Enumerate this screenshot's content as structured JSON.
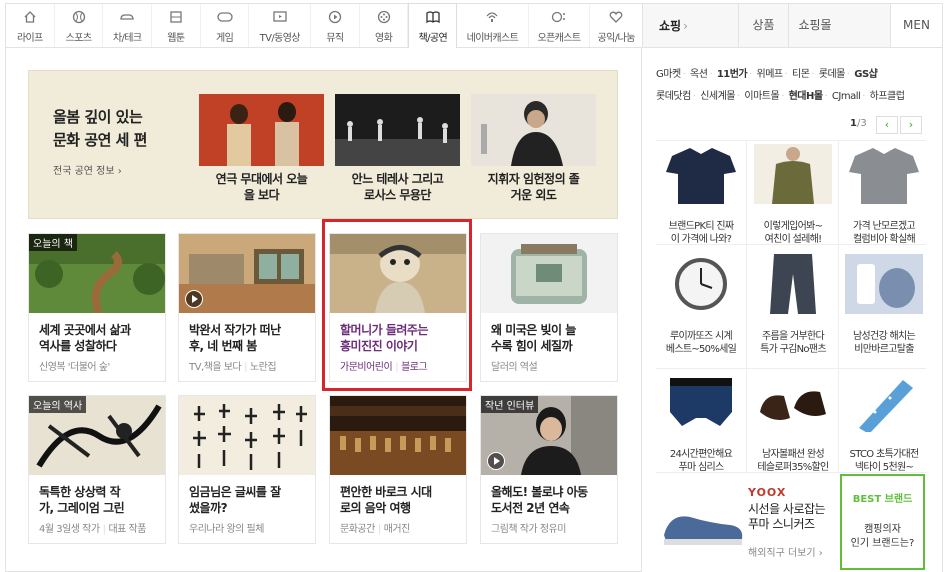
{
  "nav": {
    "tabs": [
      {
        "label": "라이프",
        "icon": "home-icon"
      },
      {
        "label": "스포츠",
        "icon": "ball-icon"
      },
      {
        "label": "차/테크",
        "icon": "car-icon"
      },
      {
        "label": "웹툰",
        "icon": "webtoon-icon"
      },
      {
        "label": "게임",
        "icon": "gamepad-icon"
      },
      {
        "label": "TV/동영상",
        "icon": "tv-icon"
      },
      {
        "label": "뮤직",
        "icon": "play-icon"
      },
      {
        "label": "영화",
        "icon": "film-reel-icon"
      },
      {
        "label": "책/공연",
        "icon": "book-icon"
      },
      {
        "label": "네이버캐스트",
        "icon": "cast-icon"
      },
      {
        "label": "오픈캐스트",
        "icon": "opencast-icon"
      },
      {
        "label": "공익/나눔",
        "icon": "heart-icon"
      }
    ],
    "active": "책/공연"
  },
  "shop": {
    "title": "쇼핑",
    "arrow": "›",
    "tabs": [
      "상품",
      "쇼핑몰"
    ],
    "men": "MEN",
    "brand_rows": [
      [
        "G마켓",
        "옥션",
        "11번가",
        "위메프",
        "티몬",
        "롯데몰",
        "GS샵"
      ],
      [
        "롯데닷컴",
        "신세계몰",
        "이마트몰",
        "현대H몰",
        "CJmall",
        "하프클럽"
      ]
    ],
    "pager": {
      "current": "1",
      "total": "3",
      "prev": "‹",
      "next": "›"
    },
    "products": [
      {
        "line1": "브랜드PK티 진짜",
        "line2": "이 가격에 나와?"
      },
      {
        "line1": "이렇게입어봐~",
        "line2": "여친이 설레해!"
      },
      {
        "line1": "가격 난모르겠고",
        "line2": "컬럼비아 확실해"
      },
      {
        "line1": "루이까또즈 시계",
        "line2": "베스트~50%세일"
      },
      {
        "line1": "주름을 거부한다",
        "line2": "특가 구김No팬츠"
      },
      {
        "line1": "남성건강 해치는",
        "line2": "비만바르고탈출"
      },
      {
        "line1": "24시간편안해요",
        "line2": "푸마 심리스"
      },
      {
        "line1": "남자볼패션 완성",
        "line2": "테슬로퍼35%할인"
      },
      {
        "line1": "STCO 초특가대전",
        "line2": "넥타이 5천원~"
      }
    ],
    "banner": {
      "brand": "YOOX",
      "line1": "시선을 사로잡는",
      "line2": "푸마 스니커즈",
      "sub": "해외직구 더보기 ›"
    },
    "best": {
      "heading": "BEST 브랜드",
      "line1": "캠핑의자",
      "line2": "인기 브랜드는?"
    }
  },
  "feature": {
    "title_line1": "올봄 깊이 있는",
    "title_line2": "문화 공연 세 편",
    "link": "전국 공연 정보 ›",
    "items": [
      {
        "line1": "연극 무대에서 오늘",
        "line2": "을 보다"
      },
      {
        "line1": "안느 테레사 그리고",
        "line2": "로사스 무용단"
      },
      {
        "line1": "지휘자 임헌정의 졸",
        "line2": "거운 외도"
      }
    ]
  },
  "cards": [
    {
      "badge": "오늘의 책",
      "line1": "세계 곳곳에서 삶과",
      "line2": "역사를 성찰하다",
      "source": "신영복 '더불어 숲'",
      "sub": ""
    },
    {
      "badge": "",
      "line1": "박완서 작가가 떠난",
      "line2": "후, 네 번째 봄",
      "source": "TV,책을 보다",
      "sub": "노란집"
    },
    {
      "badge": "",
      "line1": "할머니가 들려주는",
      "line2": "흥미진진 이야기",
      "source": "가문비어린이",
      "sub": "블로그"
    },
    {
      "badge": "",
      "line1": "왜 미국은 빚이 늘",
      "line2": "수록 힘이 세질까",
      "source": "달러의 역설",
      "sub": ""
    },
    {
      "badge": "오늘의 역사",
      "line1": "독특한 상상력 작",
      "line2": "가, 그레이엄 그린",
      "source": "4월 3일생 작가",
      "sub": "대표 작품"
    },
    {
      "badge": "",
      "line1": "임금님은 글씨를 잘",
      "line2": "썼을까?",
      "source": "우리나라 왕의 필체",
      "sub": ""
    },
    {
      "badge": "",
      "line1": "편안한 바로크 시대",
      "line2": "로의 음악 여행",
      "source": "문화공간",
      "sub": "매거진"
    },
    {
      "badge": "작년 인터뷰",
      "line1": "올해도! 볼로냐 아동",
      "line2": "도서전 2년 연속",
      "source": "그림책 작가 정유미",
      "sub": ""
    }
  ],
  "colors": {
    "highlight": "#d8242c",
    "feature_bg": "#f1ecd9",
    "accent_green": "#5fbf3a"
  }
}
